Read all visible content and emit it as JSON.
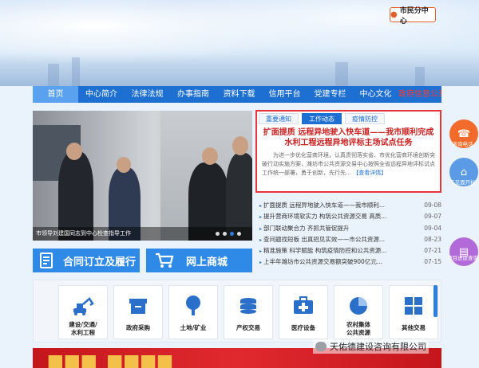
{
  "header": {
    "location_button": "市民分中心"
  },
  "nav": {
    "items": [
      {
        "label": "首页",
        "active": true
      },
      {
        "label": "中心简介"
      },
      {
        "label": "法律法规"
      },
      {
        "label": "办事指南"
      },
      {
        "label": "资料下载"
      },
      {
        "label": "信用平台"
      },
      {
        "label": "党建专栏"
      },
      {
        "label": "中心文化"
      },
      {
        "label": "政府信息公开",
        "highlight": "red"
      }
    ]
  },
  "carousel": {
    "caption": "市领导刘建国同志到中心检查指导工作",
    "dots": 4,
    "active_dot": 2
  },
  "promos": {
    "contract": "合同订立及履行",
    "mall": "网上商城"
  },
  "news_panel": {
    "tabs": [
      "重要通知",
      "工作动态",
      "疫情防控"
    ],
    "active_tab": 1,
    "headline": "扩面提质 远程异地驶入快车道——我市顺利完成水利工程远程异地评标主场试点任务",
    "summary": "为进一步优化营商环境，认真贯彻落实省、市优化营商环境创新突破行动实施方案，潍坊市公共资源交易中心按照全省远程异地评标试点工作统一部署，勇于创新，先行先…",
    "more": "【查看详情】"
  },
  "news_list": [
    {
      "title": "扩面提质 远程异地驶入快车道——我市顺利...",
      "date": "09-08"
    },
    {
      "title": "提升营商环境软实力 构筑公共资源交易 高质...",
      "date": "09-07"
    },
    {
      "title": "部门联动聚合力 齐抓共管促提升",
      "date": "09-04"
    },
    {
      "title": "查问题找短板 出真招见实效——市公共资源...",
      "date": "08-23"
    },
    {
      "title": "精准施策 科学赋能 构筑疫情防控和公共资源...",
      "date": "07-21"
    },
    {
      "title": "上半年潍坊市公共资源交易额突破900亿元...",
      "date": "07-15"
    }
  ],
  "services": [
    {
      "label": "建设/交通/\n水利工程",
      "icon": "excavator-icon"
    },
    {
      "label": "政府采购",
      "icon": "box-icon"
    },
    {
      "label": "土地/矿业",
      "icon": "tree-icon"
    },
    {
      "label": "产权交易",
      "icon": "coins-icon"
    },
    {
      "label": "医疗设备",
      "icon": "medical-kit-icon"
    },
    {
      "label": "农村集体\n公共资源",
      "icon": "pie-chart-icon"
    },
    {
      "label": "其他交易",
      "icon": "grid-icon"
    }
  ],
  "float_buttons": [
    {
      "label": "咨询电话",
      "color": "#f26b2a",
      "icon": "phone-icon"
    },
    {
      "label": "不见面开标",
      "color": "#5b9be6",
      "icon": "house-icon"
    },
    {
      "label": "项目进度查询",
      "color": "#b36ad9",
      "icon": "document-icon"
    }
  ],
  "watermark": "天佑德建设咨询有限公司",
  "colors": {
    "nav_blue": "#1d6fd1",
    "accent_red": "#e8333c"
  }
}
